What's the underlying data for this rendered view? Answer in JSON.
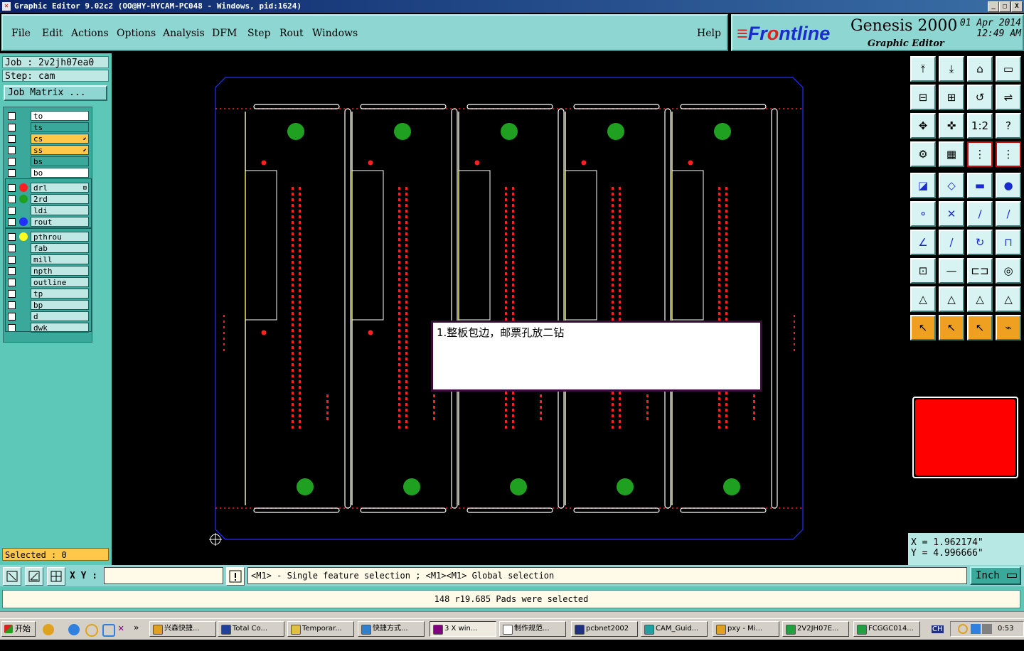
{
  "window": {
    "title": "Graphic Editor 9.02c2  (OO@HY-HYCAM-PC048 - Windows, pid:1624)",
    "minimize": "_",
    "maximize": "□",
    "close": "X"
  },
  "menu": {
    "items": [
      "File",
      "Edit",
      "Actions",
      "Options",
      "Analysis",
      "DFM",
      "Step",
      "Rout",
      "Windows"
    ],
    "help": "Help"
  },
  "brand": {
    "logo_prefix": "Fr",
    "logo_o": "o",
    "logo_suffix": "ntline",
    "product": "Genesis 2000",
    "subtitle": "Graphic Editor",
    "date": "01 Apr 2014",
    "time": "12:49  AM"
  },
  "job": {
    "job_line": "Job : 2v2jh07ea0",
    "step_line": "Step: cam",
    "matrix_button": "Job Matrix ..."
  },
  "layers": {
    "group1": [
      {
        "name": "to",
        "color": "#ffffff"
      },
      {
        "name": "ts",
        "color": "#3aa89a"
      },
      {
        "name": "cs",
        "color": "#ffc84a",
        "mark": "⬋"
      },
      {
        "name": "ss",
        "color": "#ffc84a",
        "mark": "⬋"
      },
      {
        "name": "bs",
        "color": "#3aa89a"
      },
      {
        "name": "bo",
        "color": "#ffffff"
      }
    ],
    "group2": [
      {
        "name": "drl",
        "color": "#bfe8e4",
        "dot": "#ff2020",
        "mark": "⊞"
      },
      {
        "name": "2rd",
        "color": "#bfe8e4",
        "dot": "#20a020"
      },
      {
        "name": "ldi",
        "color": "#bfe8e4"
      },
      {
        "name": "rout",
        "color": "#bfe8e4",
        "dot": "#2030ff"
      }
    ],
    "group3": [
      {
        "name": "pthrou",
        "color": "#bfe8e4",
        "dot": "#ffff20"
      },
      {
        "name": "fab",
        "color": "#bfe8e4"
      },
      {
        "name": "mill",
        "color": "#bfe8e4"
      },
      {
        "name": "npth",
        "color": "#bfe8e4"
      },
      {
        "name": "outline",
        "color": "#bfe8e4"
      },
      {
        "name": "tp",
        "color": "#bfe8e4"
      },
      {
        "name": "bp",
        "color": "#bfe8e4"
      },
      {
        "name": "d",
        "color": "#bfe8e4"
      },
      {
        "name": "dwk",
        "color": "#bfe8e4"
      }
    ]
  },
  "selected_label": "Selected : 0",
  "popup_note": "1.整板包边，邮票孔放二钻",
  "coordinates": {
    "x_line": "X = 1.962174\"",
    "y_line": "Y = 4.996666\""
  },
  "command": {
    "xy_label": "X Y :",
    "xy_value": "",
    "message": "<M1> - Single feature selection ; <M1><M1> Global selection",
    "unit": "Inch"
  },
  "status_text": "148 r19.685 Pads were selected",
  "taskbar": {
    "start": "开始",
    "tasks": [
      {
        "label": "兴森快捷...",
        "color": "#e0a020"
      },
      {
        "label": "Total Co...",
        "color": "#2040a0"
      },
      {
        "label": "Temporar...",
        "color": "#e0c040"
      },
      {
        "label": "快捷方式...",
        "color": "#3080d0"
      },
      {
        "label": "3 X win...",
        "color": "#800080"
      },
      {
        "label": "制作规范...",
        "color": "#ffffff"
      },
      {
        "label": "pcbnet2002",
        "color": "#203080"
      },
      {
        "label": "CAM_Guid...",
        "color": "#20a0a0"
      },
      {
        "label": "pxy - Mi...",
        "color": "#e0a020"
      },
      {
        "label": "2V2JH07E...",
        "color": "#20a040"
      },
      {
        "label": "FCGGC014...",
        "color": "#20a040"
      }
    ],
    "clock": "0:53"
  },
  "colors": {
    "accent": "#8ed6d2",
    "panel": "#5ec8b8",
    "active_color": "#ff0000"
  }
}
